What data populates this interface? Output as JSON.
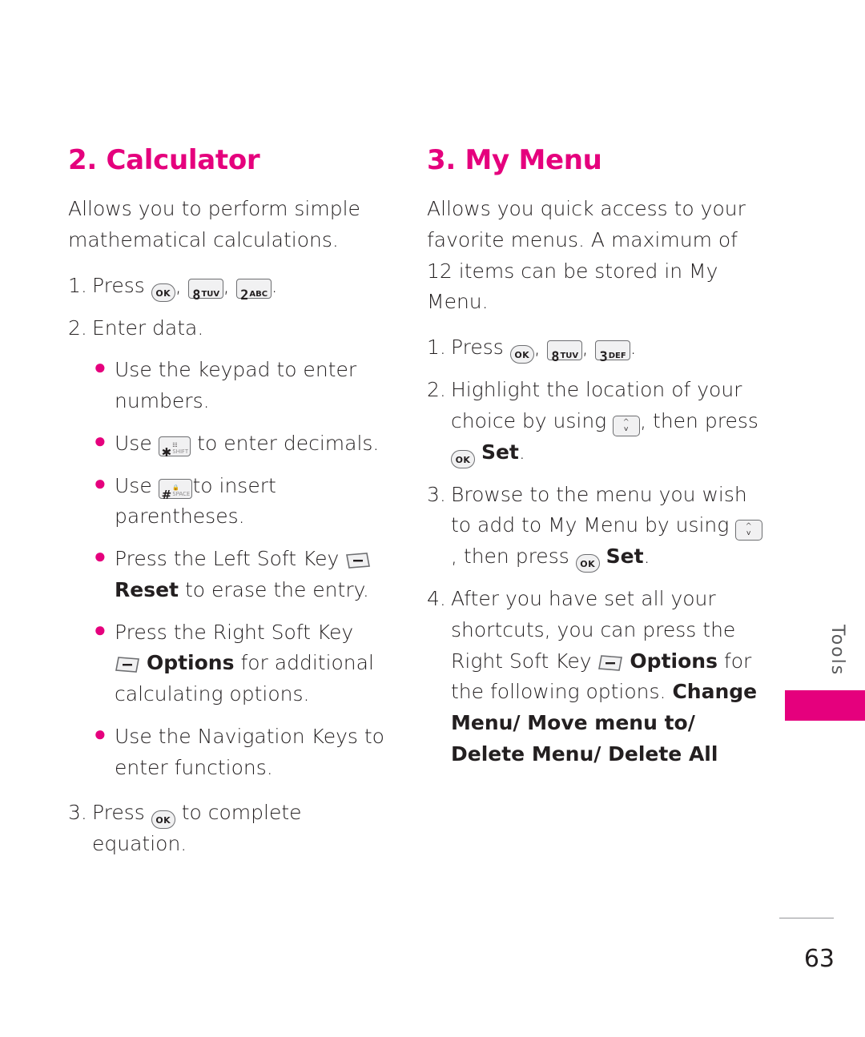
{
  "page": {
    "number": "63",
    "side_tab_label": "Tools"
  },
  "left_column": {
    "title": "2. Calculator",
    "intro": "Allows you to perform simple mathematical calculations.",
    "step1_num": "1.",
    "step1_pre": "Press",
    "step1_post": ".",
    "step1_keys": [
      "OK",
      "8 TUV",
      "2 ABC"
    ],
    "step2_num": "2.",
    "step2_text": "Enter data.",
    "bullet1": "Use the keypad to enter numbers.",
    "bullet2_pre": "Use",
    "bullet2_post": "to enter decimals.",
    "bullet2_key": "* SHIFT",
    "bullet3_pre": "Use",
    "bullet3_post": "to insert parentheses.",
    "bullet3_key": "# SPACE",
    "bullet4_pre": "Press the Left Soft Key",
    "bullet4_bold": "Reset",
    "bullet4_post": "to erase the entry.",
    "bullet5_pre": "Press the Right Soft Key",
    "bullet5_bold": "Options",
    "bullet5_post": "for additional calculating options.",
    "bullet6": "Use the Navigation Keys to enter functions.",
    "step3_num": "3.",
    "step3_pre": "Press",
    "step3_post": "to complete equation.",
    "step3_key": "OK"
  },
  "right_column": {
    "title": "3. My Menu",
    "intro": "Allows you quick access to your favorite menus. A maximum of 12 items can be stored in My Menu.",
    "step1_num": "1.",
    "step1_pre": "Press",
    "step1_post": ".",
    "step1_keys": [
      "OK",
      "8 TUV",
      "3 DEF"
    ],
    "step2_num": "2.",
    "step2_a": "Highlight the location of your choice by using",
    "step2_b": ", then press",
    "step2_bold": "Set",
    "step2_end": ".",
    "step3_num": "3.",
    "step3_a": "Browse to the menu you wish to add to My Menu by using",
    "step3_b": ", then press",
    "step3_bold": "Set",
    "step3_end": ".",
    "step4_num": "4.",
    "step4_a": "After you have set all your shortcuts, you can press the Right Soft Key",
    "step4_bold": "Options",
    "step4_b": "for the following options.",
    "step4_options": "Change Menu/ Move menu to/ Delete Menu/ Delete All"
  },
  "colors": {
    "accent": "#e5007d",
    "text": "#231f20",
    "key_border": "#6d6e71",
    "key_fill": "#f1f1f2"
  }
}
